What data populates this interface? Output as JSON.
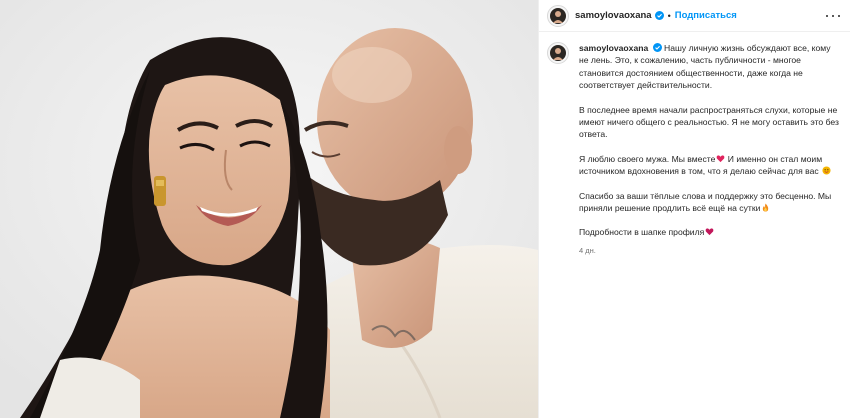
{
  "post": {
    "username": "samoylovaoxana",
    "follow_label": "Подписаться",
    "separator": "•",
    "time_ago": "4 дн.",
    "caption": {
      "p1": "Нашу личную жизнь обсуждают все, кому не лень. Это, к сожалению, часть публичности - многое становится достоянием общественности, даже когда не соответствует действительности.",
      "p2": "В последнее время начали распространяться слухи, которые не имеют ничего общего с реальностью. Я не могу оставить это без ответа.",
      "p3a": "Я люблю своего мужа. Мы вместе",
      "p3b": " И именно он стал моим источником вдохновения в том, что я делаю сейчас для вас",
      "p4": "Спасибо за ваши тёплые слова и поддержку это бесценно. Мы приняли решение продлить всё ещё на сутки",
      "p5": "Подробности в шапке профиля"
    },
    "icons": {
      "verified": "verified-badge-icon",
      "more": "more-options-icon",
      "heart": "red-heart-emoji",
      "pray": "smiling-face-emoji",
      "fire": "flame-emoji",
      "broken": "heart-emoji"
    }
  },
  "colors": {
    "accent": "#0095f6",
    "text": "#262626",
    "muted": "#737373"
  }
}
